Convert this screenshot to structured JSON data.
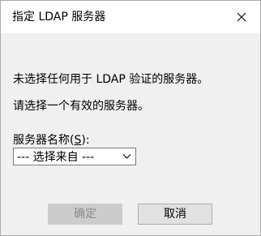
{
  "dialog": {
    "title": "指定 LDAP 服务器",
    "close_icon": "close-icon"
  },
  "message": {
    "line1": "未选择任何用于 LDAP 验证的服务器。",
    "line2": "请选择一个有效的服务器。"
  },
  "server_name": {
    "label_prefix": "服务器名称(",
    "label_accesskey": "S",
    "label_suffix": "):",
    "selected": "--- 选择来自 ---",
    "arrow_icon": "chevron-down-icon"
  },
  "buttons": {
    "ok_label": "确定",
    "cancel_label": "取消"
  }
}
